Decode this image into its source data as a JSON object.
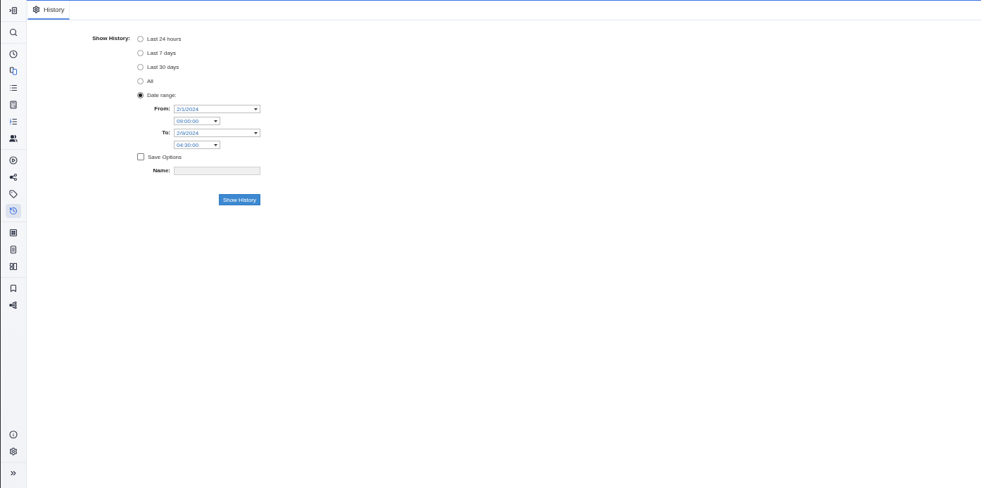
{
  "sidebar": {
    "groups": [
      {
        "items": [
          {
            "selected": false
          }
        ]
      },
      {
        "items": [
          {
            "selected": false
          }
        ]
      },
      {
        "items": [
          {
            "selected": false
          },
          {
            "selected": false
          },
          {
            "selected": false
          },
          {
            "selected": false
          },
          {
            "selected": false
          },
          {
            "selected": false
          }
        ]
      },
      {
        "items": [
          {
            "selected": false
          },
          {
            "selected": false
          },
          {
            "selected": false
          },
          {
            "selected": true
          }
        ]
      },
      {
        "items": [
          {
            "selected": false
          },
          {
            "selected": false
          },
          {
            "selected": false
          }
        ]
      },
      {
        "items": [
          {
            "selected": false
          },
          {
            "selected": false
          }
        ]
      }
    ],
    "footer_groups": [
      {
        "items": [
          {
            "selected": false
          },
          {
            "selected": false
          }
        ]
      },
      {
        "items": [
          {
            "selected": false
          }
        ]
      }
    ]
  },
  "tabs": [
    {
      "label": "History",
      "selected": true
    }
  ],
  "form": {
    "show_history_label": "Show History:",
    "options": [
      {
        "label": "Last 24 hours",
        "selected": false
      },
      {
        "label": "Last 7 days",
        "selected": false
      },
      {
        "label": "Last 30 days",
        "selected": false
      },
      {
        "label": "All",
        "selected": false
      },
      {
        "label": "Date range:",
        "selected": true
      }
    ],
    "date_range": {
      "from_label": "From:",
      "from_date": "2/1/2024",
      "from_time": "09:00:00",
      "to_label": "To:",
      "to_date": "2/9/2024",
      "to_time": "04:30:00"
    },
    "save_options": {
      "label": "Save Options",
      "checked": false
    },
    "name": {
      "label": "Name:",
      "disabled": true
    },
    "submit_button": "Show History"
  }
}
